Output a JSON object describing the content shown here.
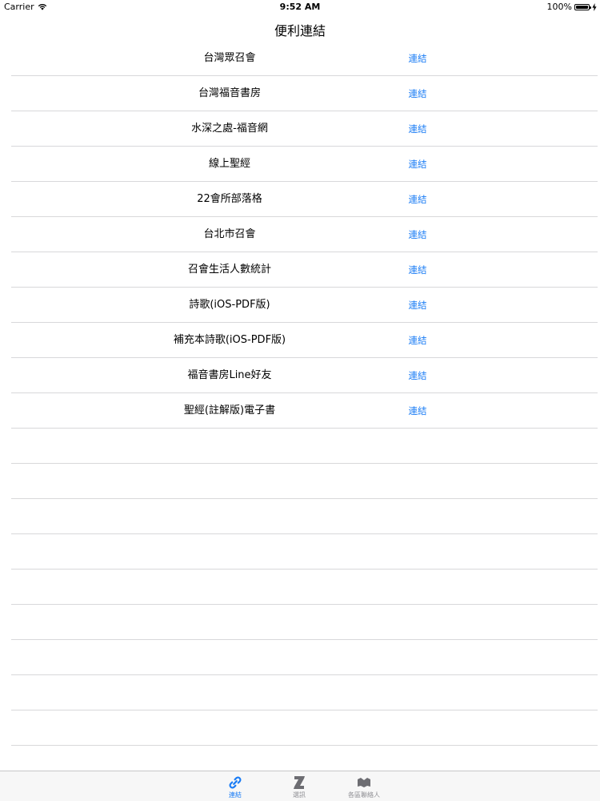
{
  "status_bar": {
    "carrier": "Carrier",
    "time": "9:52 AM",
    "battery": "100%",
    "battery_level": 1.0
  },
  "nav": {
    "title": "便利連結"
  },
  "links": [
    {
      "title": "台灣眾召會",
      "action": "連結"
    },
    {
      "title": "台灣福音書房",
      "action": "連結"
    },
    {
      "title": "水深之處-福音網",
      "action": "連結"
    },
    {
      "title": "線上聖經",
      "action": "連結"
    },
    {
      "title": "22會所部落格",
      "action": "連結"
    },
    {
      "title": "台北市召會",
      "action": "連結"
    },
    {
      "title": "召會生活人數統計",
      "action": "連結"
    },
    {
      "title": "詩歌(iOS-PDF版)",
      "action": "連結"
    },
    {
      "title": "補充本詩歌(iOS-PDF版)",
      "action": "連結"
    },
    {
      "title": "福音書房Line好友",
      "action": "連結"
    },
    {
      "title": "聖經(註解版)電子書",
      "action": "連結"
    }
  ],
  "tabs": [
    {
      "label": "連結",
      "icon": "link-icon",
      "active": true
    },
    {
      "label": "選訊",
      "icon": "news-icon",
      "active": false
    },
    {
      "label": "各區聯絡人",
      "icon": "contacts-icon",
      "active": false
    }
  ],
  "colors": {
    "accent": "#1a7cf5",
    "separator": "#d8d8da",
    "tab_inactive": "#8e8e93",
    "tab_bar_bg": "#f7f7f7"
  }
}
